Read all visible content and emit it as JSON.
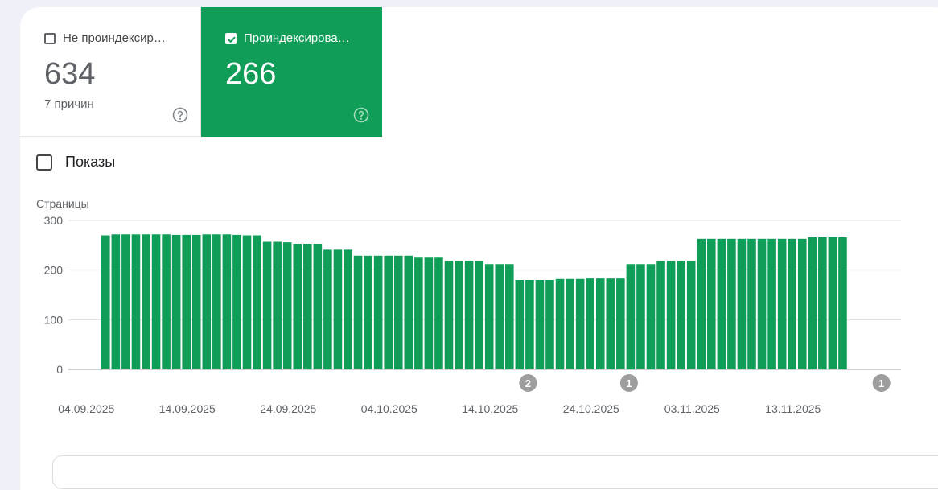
{
  "tiles": {
    "not_indexed": {
      "label": "Не проиндексир…",
      "value": "634",
      "sub": "7 причин",
      "checked": false
    },
    "indexed": {
      "label": "Проиндексирова…",
      "value": "266",
      "checked": true
    }
  },
  "legend": {
    "label": "Показы"
  },
  "chart_data": {
    "type": "bar",
    "ylabel": "Страницы",
    "ylim": [
      0,
      300
    ],
    "y_ticks": [
      "300",
      "200",
      "100",
      "0"
    ],
    "x_tick_labels": [
      "04.09.2025",
      "14.09.2025",
      "24.09.2025",
      "04.10.2025",
      "14.10.2025",
      "24.10.2025",
      "03.11.2025",
      "13.11.2025"
    ],
    "x_tick_indices": [
      0,
      10,
      20,
      30,
      40,
      50,
      60,
      70
    ],
    "series": [
      {
        "color": "#0f9d58",
        "values": [
          270,
          272,
          272,
          272,
          272,
          272,
          272,
          271,
          271,
          271,
          272,
          272,
          272,
          271,
          270,
          270,
          257,
          257,
          256,
          253,
          253,
          253,
          241,
          241,
          241,
          229,
          229,
          229,
          229,
          229,
          229,
          225,
          225,
          225,
          219,
          219,
          219,
          219,
          212,
          212,
          212,
          180,
          180,
          180,
          180,
          182,
          182,
          182,
          183,
          183,
          183,
          183,
          212,
          212,
          212,
          219,
          219,
          219,
          219,
          263,
          263,
          263,
          263,
          263,
          263,
          263,
          263,
          263,
          263,
          263,
          266,
          266,
          266,
          266
        ]
      }
    ],
    "annotations": [
      {
        "index": 42,
        "label": "2"
      },
      {
        "index": 52,
        "label": "1"
      },
      {
        "index": 77,
        "label": "1"
      }
    ],
    "grid": true,
    "legend": "top-left"
  },
  "colors": {
    "accent": "#0f9d58",
    "annotation": "#9e9e9e",
    "grid": "#e0e0e0"
  },
  "icons": {
    "help": "help-circle-icon",
    "check": "check-icon"
  }
}
